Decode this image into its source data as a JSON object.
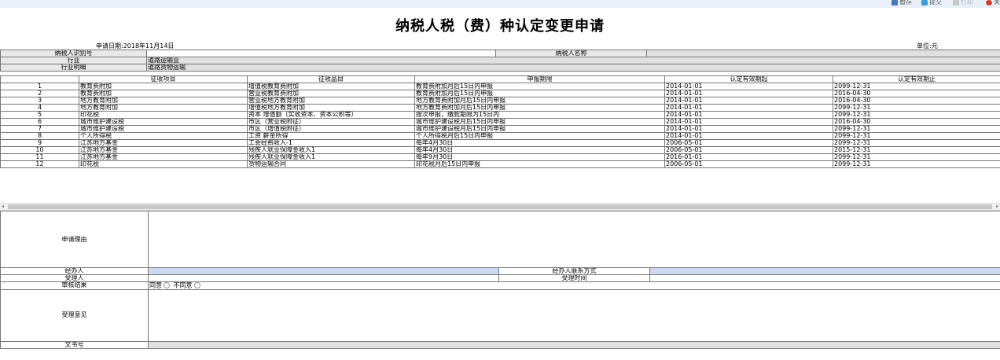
{
  "toolbar": {
    "save": "暂存",
    "submit": "提交",
    "print": "打印",
    "close": "关"
  },
  "title": "纳税人税（费）种认定变更申请",
  "meta": {
    "apply_date": "申请日期:2018年11月14日",
    "unit": "单位:元"
  },
  "info": {
    "taxpayer_id_label": "纳税人识别号",
    "taxpayer_id_value": "",
    "taxpayer_name_label": "纳税人名称",
    "taxpayer_name_value": "",
    "industry_label": "行业",
    "industry_value": "道路运输业",
    "industry_detail_label": "行业明细",
    "industry_detail_value": "道路货物运输"
  },
  "grid": {
    "columns": [
      "",
      "征收项目",
      "征收品目",
      "申报期限",
      "认定有效期起",
      "认定有效期止"
    ],
    "rows": [
      [
        "1",
        "教育费附加",
        "增值税教育费附加",
        "教育费附加月后15日内申报",
        "2014-01-01",
        "2099-12-31"
      ],
      [
        "2",
        "教育费附加",
        "营业税教育费附加",
        "教育费附加月后15日内申报",
        "2014-01-01",
        "2016-04-30"
      ],
      [
        "3",
        "地方教育附加",
        "营业税地方教育附加",
        "地方教育费附加月后15日内申报",
        "2014-01-01",
        "2016-04-30"
      ],
      [
        "4",
        "地方教育附加",
        "增值税地方教育附加",
        "地方教育费附加月后15日内申报",
        "2014-01-01",
        "2099-12-31"
      ],
      [
        "5",
        "印花税",
        "资本 增值额（实收资本、资本公积等）",
        "按次申报，缴款期限为15日内",
        "2014-01-01",
        "2099-12-31"
      ],
      [
        "6",
        "城市维护建设税",
        "市区（营业税附征）",
        "城市维护建设税月后15日内申报",
        "2014-01-01",
        "2016-04-30"
      ],
      [
        "7",
        "城市维护建设税",
        "市区（增值税附征）",
        "城市维护建设税月后15日内申报",
        "2014-01-01",
        "2099-12-31"
      ],
      [
        "8",
        "个人所得税",
        "工资 薪金所得",
        "个人所得税月后15日内申报",
        "2014-01-01",
        "2099-12-31"
      ],
      [
        "9",
        "江苏地方基金",
        "工会经费收入-1",
        "每年4月30日",
        "2006-05-01",
        "2099-12-31"
      ],
      [
        "10",
        "江苏地方基金",
        "残疾人就业保障金收入1",
        "每年4月30日",
        "2006-05-01",
        "2015-12-31"
      ],
      [
        "11",
        "江苏地方基金",
        "残疾人就业保障金收入1",
        "每年9月30日",
        "2016-01-01",
        "2099-12-31"
      ],
      [
        "12",
        "印花税",
        "货物运输合同",
        "印花税月后15日内申报",
        "2006-05-01",
        "2099-12-31"
      ]
    ]
  },
  "form": {
    "reason_label": "申请理由",
    "reason_value": "",
    "handler_label": "经办人",
    "handler_value": "",
    "handler_contact_label": "经办人联系方式",
    "handler_contact_value": "",
    "acceptor_label": "受理人",
    "accept_time_label": "受理时间",
    "review_result_label": "审核结果",
    "agree_label": "同意",
    "disagree_label": "不同意",
    "opinion_label": "受理意见",
    "doc_no_label": "文书号"
  }
}
